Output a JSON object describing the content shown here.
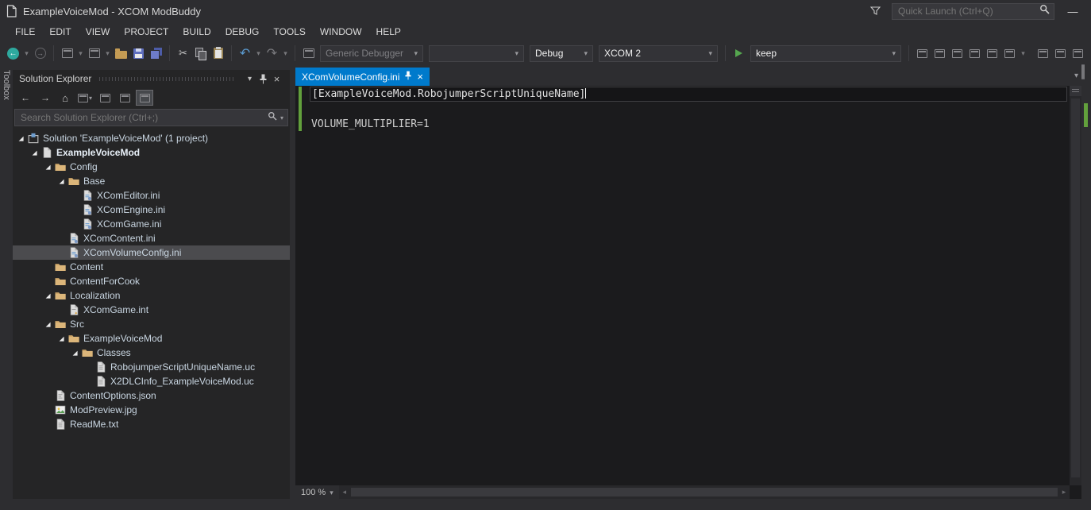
{
  "colors": {
    "accent": "#007acc",
    "chrome_bg": "#2d2d30",
    "panel_bg": "#252526",
    "editor_bg": "#1b1b1d",
    "selection_bg": "#4b4b4e",
    "change_mark": "#62a03c"
  },
  "title_bar": {
    "title": "ExampleVoiceMod - XCOM ModBuddy",
    "quick_launch_placeholder": "Quick Launch (Ctrl+Q)"
  },
  "menu": [
    "FILE",
    "EDIT",
    "VIEW",
    "PROJECT",
    "BUILD",
    "DEBUG",
    "TOOLS",
    "WINDOW",
    "HELP"
  ],
  "toolbar": {
    "debugger_combo": "Generic Debugger",
    "solution_config_combo": "Debug",
    "platform_combo": "XCOM 2",
    "deploy_combo": "keep"
  },
  "toolbox_tab_label": "Toolbox",
  "solution_explorer": {
    "title": "Solution Explorer",
    "search_placeholder": "Search Solution Explorer (Ctrl+;)",
    "tree": [
      {
        "label": "Solution 'ExampleVoiceMod' (1 project)",
        "level": 0,
        "expanded": true,
        "icon": "solution"
      },
      {
        "label": "ExampleVoiceMod",
        "level": 1,
        "expanded": true,
        "icon": "project",
        "bold": true
      },
      {
        "label": "Config",
        "level": 2,
        "expanded": true,
        "icon": "folder"
      },
      {
        "label": "Base",
        "level": 3,
        "expanded": true,
        "icon": "folder"
      },
      {
        "label": "XComEditor.ini",
        "level": 4,
        "icon": "ini"
      },
      {
        "label": "XComEngine.ini",
        "level": 4,
        "icon": "ini"
      },
      {
        "label": "XComGame.ini",
        "level": 4,
        "icon": "ini"
      },
      {
        "label": "XComContent.ini",
        "level": 3,
        "icon": "ini"
      },
      {
        "label": "XComVolumeConfig.ini",
        "level": 3,
        "icon": "ini",
        "selected": true
      },
      {
        "label": "Content",
        "level": 2,
        "icon": "folder"
      },
      {
        "label": "ContentForCook",
        "level": 2,
        "icon": "folder"
      },
      {
        "label": "Localization",
        "level": 2,
        "expanded": true,
        "icon": "folder"
      },
      {
        "label": "XComGame.int",
        "level": 3,
        "icon": "int"
      },
      {
        "label": "Src",
        "level": 2,
        "expanded": true,
        "icon": "folder"
      },
      {
        "label": "ExampleVoiceMod",
        "level": 3,
        "expanded": true,
        "icon": "folder"
      },
      {
        "label": "Classes",
        "level": 4,
        "expanded": true,
        "icon": "folder"
      },
      {
        "label": "RobojumperScriptUniqueName.uc",
        "level": 5,
        "icon": "uc"
      },
      {
        "label": "X2DLCInfo_ExampleVoiceMod.uc",
        "level": 5,
        "icon": "uc"
      },
      {
        "label": "ContentOptions.json",
        "level": 2,
        "icon": "json"
      },
      {
        "label": "ModPreview.jpg",
        "level": 2,
        "icon": "jpg"
      },
      {
        "label": "ReadMe.txt",
        "level": 2,
        "icon": "txt"
      }
    ]
  },
  "editor": {
    "tab_label": "XComVolumeConfig.ini",
    "zoom_level": "100 %",
    "active_line_index": 0,
    "lines": [
      "[ExampleVoiceMod.RobojumperScriptUniqueName]",
      "",
      "VOLUME_MULTIPLIER=1"
    ]
  }
}
